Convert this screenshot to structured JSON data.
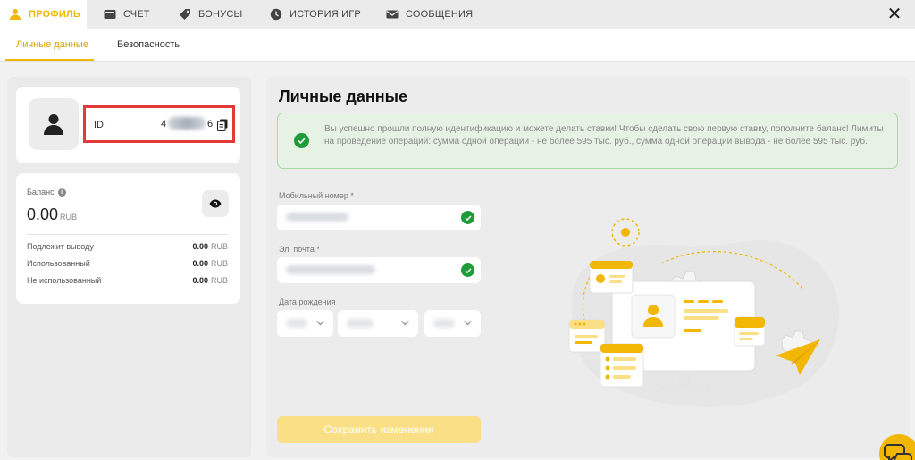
{
  "tabs": [
    {
      "label": "ПРОФИЛЬ",
      "icon": "user-icon",
      "active": true
    },
    {
      "label": "СЧЕТ",
      "icon": "wallet-icon",
      "active": false
    },
    {
      "label": "БОНУСЫ",
      "icon": "tag-icon",
      "active": false
    },
    {
      "label": "ИСТОРИЯ ИГР",
      "icon": "clock-icon",
      "active": false
    },
    {
      "label": "СООБЩЕНИЯ",
      "icon": "envelope-icon",
      "active": false
    }
  ],
  "subtabs": [
    {
      "label": "Личные данные",
      "active": true
    },
    {
      "label": "Безопасность",
      "active": false
    }
  ],
  "profile": {
    "id_label": "ID:",
    "id_prefix": "4",
    "id_suffix": "6"
  },
  "balance": {
    "label": "Баланс",
    "value": "0.00",
    "currency": "RUB",
    "rows": [
      {
        "label": "Подлежит выводу",
        "amount": "0.00",
        "currency": "RUB"
      },
      {
        "label": "Использованный",
        "amount": "0.00",
        "currency": "RUB"
      },
      {
        "label": "Не использованный",
        "amount": "0.00",
        "currency": "RUB"
      }
    ]
  },
  "main": {
    "title": "Личные данные",
    "notice": "Вы успешно прошли полную идентификацию и можете делать ставки! Чтобы сделать свою первую ставку, пополните баланс! Лимиты на проведение операций: сумма одной операции - не более 595 тыс. руб., сумма одной операции вывода - не более 595 тыс. руб.",
    "phone_label": "Мобильный номер *",
    "email_label": "Эл. почта *",
    "birth_label": "Дата рождения",
    "save_label": "Сохранить изменения"
  },
  "colors": {
    "accent": "#f2b705",
    "success": "#1f9b3a",
    "alert_border": "#e53935"
  }
}
